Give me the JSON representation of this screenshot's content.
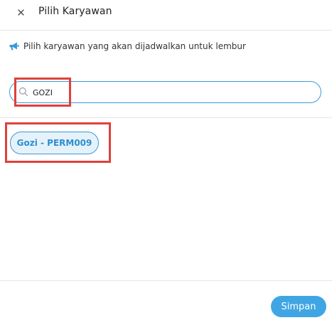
{
  "dialog": {
    "title": "Pilih Karyawan",
    "close_icon": "close-icon"
  },
  "info": {
    "icon": "megaphone-icon",
    "text": "Pilih karyawan yang akan dijadwalkan untuk lembur"
  },
  "search": {
    "icon": "search-icon",
    "value": "GOZI"
  },
  "results": [
    {
      "label": "Gozi - PERM009",
      "selected": true
    }
  ],
  "footer": {
    "save_label": "Simpan"
  },
  "colors": {
    "accent": "#3a9ad7",
    "button": "#40a6e3",
    "chip_bg": "#e6f2fa",
    "annotation": "#e0403a"
  }
}
